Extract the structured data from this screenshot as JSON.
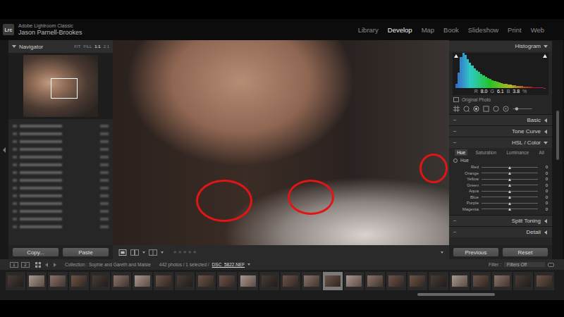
{
  "app": {
    "logo": "Lrc",
    "product": "Adobe Lightroom Classic",
    "user": "Jason Parnell-Brookes"
  },
  "modules": [
    {
      "label": "Library",
      "selected": false
    },
    {
      "label": "Develop",
      "selected": true
    },
    {
      "label": "Map",
      "selected": false
    },
    {
      "label": "Book",
      "selected": false
    },
    {
      "label": "Slideshow",
      "selected": false
    },
    {
      "label": "Print",
      "selected": false
    },
    {
      "label": "Web",
      "selected": false
    }
  ],
  "navigator": {
    "title": "Navigator",
    "expanded": true,
    "zoom": [
      {
        "label": "FIT",
        "selected": false
      },
      {
        "label": "FILL",
        "selected": false
      },
      {
        "label": "1:1",
        "selected": true
      },
      {
        "label": "2:1",
        "selected": false
      }
    ]
  },
  "collections": [
    {
      "blurred": true
    },
    {
      "blurred": true
    },
    {
      "blurred": true
    },
    {
      "blurred": true
    },
    {
      "blurred": true
    },
    {
      "blurred": true
    },
    {
      "blurred": true
    },
    {
      "blurred": true
    },
    {
      "blurred": true
    },
    {
      "blurred": true
    },
    {
      "blurred": true
    },
    {
      "blurred": true
    },
    {
      "blurred": true
    },
    {
      "blurred": true
    }
  ],
  "left_buttons": [
    "Copy...",
    "Paste"
  ],
  "photo": {
    "annotations": [
      {
        "kind": "circle"
      },
      {
        "kind": "circle"
      },
      {
        "kind": "circle"
      }
    ]
  },
  "toolbar": {
    "star_glyphs": [
      "★",
      "★",
      "★",
      "★",
      "★"
    ],
    "stars": 0
  },
  "histogram": {
    "title": "Histogram",
    "values": [
      12,
      45,
      88,
      100,
      94,
      82,
      72,
      64,
      57,
      51,
      46,
      41,
      37,
      33,
      29,
      26,
      23,
      21,
      19,
      17,
      15,
      13,
      12,
      11,
      10,
      9,
      8,
      7,
      6,
      6,
      5,
      5,
      4,
      4,
      3,
      3,
      3,
      2,
      2,
      1
    ],
    "readout": [
      {
        "label": "R",
        "value": "8.0"
      },
      {
        "label": "G",
        "value": "6.1"
      },
      {
        "label": "B",
        "value": "3.8"
      }
    ],
    "unit": "%",
    "source": "Original Photo"
  },
  "panels_before": [
    {
      "label": "Basic",
      "expanded": false
    },
    {
      "label": "Tone Curve",
      "expanded": false
    }
  ],
  "hsl": {
    "title": "HSL / Color",
    "expanded": true,
    "tabs": [
      {
        "label": "Hue",
        "selected": true
      },
      {
        "label": "Saturation",
        "selected": false
      },
      {
        "label": "Luminance",
        "selected": false
      },
      {
        "label": "All",
        "selected": false
      }
    ],
    "section": "Hue",
    "sliders": [
      {
        "name": "Red",
        "value": "0",
        "level": 0.5
      },
      {
        "name": "Orange",
        "value": "0",
        "level": 0.5
      },
      {
        "name": "Yellow",
        "value": "0",
        "level": 0.5
      },
      {
        "name": "Green",
        "value": "0",
        "level": 0.5
      },
      {
        "name": "Aqua",
        "value": "0",
        "level": 0.5
      },
      {
        "name": "Blue",
        "value": "0",
        "level": 0.5
      },
      {
        "name": "Purple",
        "value": "0",
        "level": 0.5
      },
      {
        "name": "Magenta",
        "value": "0",
        "level": 0.5
      }
    ]
  },
  "panels_after": [
    {
      "label": "Split Toning",
      "expanded": false
    },
    {
      "label": "Detail",
      "expanded": false
    }
  ],
  "right_buttons": [
    "Previous",
    "Reset"
  ],
  "filmstrip": {
    "screens": [
      "1",
      "2"
    ],
    "collection": "Collection : Sophie and Gareth and Maisie",
    "count": "442 photos / 1 selected /",
    "file": "DSC_5822.NEF",
    "filter_label": "Filter :",
    "filter": "Filters Off",
    "thumbnails": [
      {
        "selected": false
      },
      {
        "selected": false
      },
      {
        "selected": false
      },
      {
        "selected": false
      },
      {
        "selected": false
      },
      {
        "selected": false
      },
      {
        "selected": false
      },
      {
        "selected": false
      },
      {
        "selected": false
      },
      {
        "selected": false
      },
      {
        "selected": false
      },
      {
        "selected": false
      },
      {
        "selected": false
      },
      {
        "selected": false
      },
      {
        "selected": false
      },
      {
        "selected": true
      },
      {
        "selected": false
      },
      {
        "selected": false
      },
      {
        "selected": false
      },
      {
        "selected": false
      },
      {
        "selected": false
      },
      {
        "selected": false
      },
      {
        "selected": false
      },
      {
        "selected": false
      },
      {
        "selected": false
      },
      {
        "selected": false
      }
    ]
  }
}
